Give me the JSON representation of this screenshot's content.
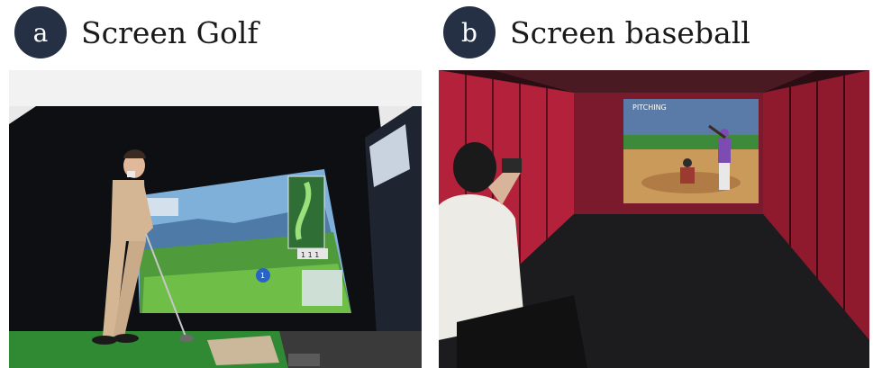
{
  "panels": [
    {
      "letter": "a",
      "caption": "Screen Golf"
    },
    {
      "letter": "b",
      "caption": "Screen baseball"
    }
  ],
  "golf_screen": {
    "score_card": "1 1 1",
    "hole_badge": "1"
  },
  "baseball_screen": {
    "top_text": "PITCHING"
  },
  "colors": {
    "badge": "#253044",
    "turf": "#2f8a33",
    "cage": "#c8283f"
  }
}
